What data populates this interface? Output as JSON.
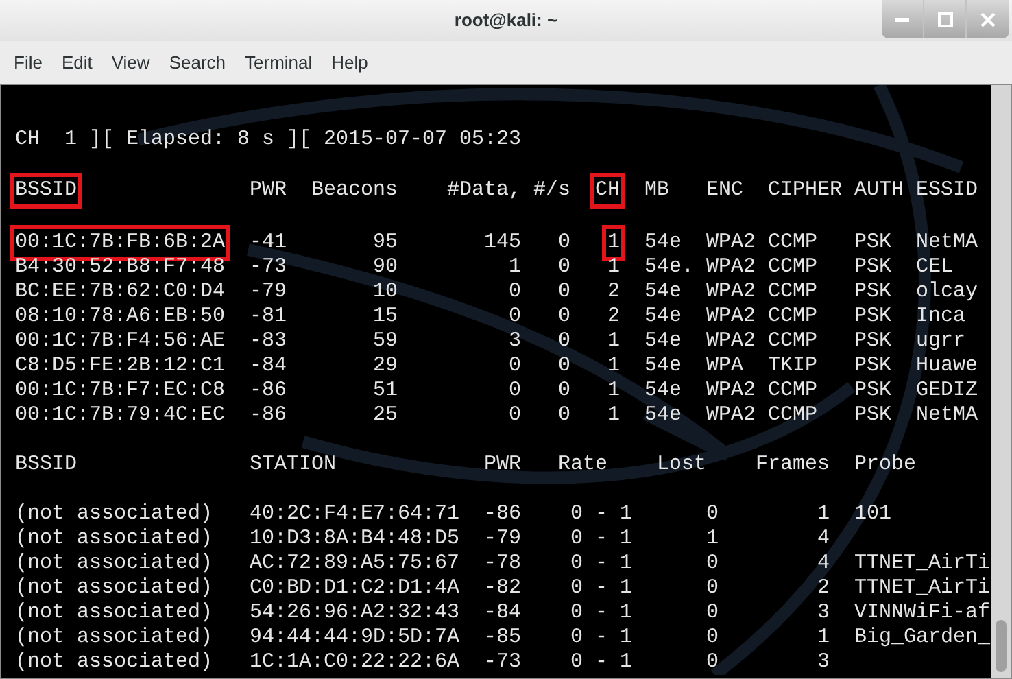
{
  "window": {
    "title": "root@kali: ~"
  },
  "menu": [
    "File",
    "Edit",
    "View",
    "Search",
    "Terminal",
    "Help"
  ],
  "status_line": "CH  1 ][ Elapsed: 8 s ][ 2015-07-07 05:23",
  "networks": {
    "columns": [
      {
        "label": "BSSID",
        "highlighted": true
      },
      {
        "label": "PWR",
        "highlighted": false
      },
      {
        "label": "Beacons",
        "highlighted": false
      },
      {
        "label": "#Data,",
        "highlighted": false
      },
      {
        "label": "#/s",
        "highlighted": false
      },
      {
        "label": "CH",
        "highlighted": true
      },
      {
        "label": "MB",
        "highlighted": false
      },
      {
        "label": "ENC",
        "highlighted": false
      },
      {
        "label": "CIPHER",
        "highlighted": false
      },
      {
        "label": "AUTH",
        "highlighted": false
      },
      {
        "label": "ESSID",
        "highlighted": false
      }
    ],
    "rows": [
      {
        "highlighted": true,
        "cells": [
          "00:1C:7B:FB:6B:2A",
          "-41",
          "95",
          "145",
          "0",
          "1",
          "54e",
          "WPA2",
          "CCMP",
          "PSK",
          "NetMA"
        ]
      },
      {
        "highlighted": false,
        "cells": [
          "B4:30:52:B8:F7:48",
          "-73",
          "90",
          "1",
          "0",
          "1",
          "54e.",
          "WPA2",
          "CCMP",
          "PSK",
          "CEL"
        ]
      },
      {
        "highlighted": false,
        "cells": [
          "BC:EE:7B:62:C0:D4",
          "-79",
          "10",
          "0",
          "0",
          "2",
          "54e",
          "WPA2",
          "CCMP",
          "PSK",
          "olcay"
        ]
      },
      {
        "highlighted": false,
        "cells": [
          "08:10:78:A6:EB:50",
          "-81",
          "15",
          "0",
          "0",
          "2",
          "54e",
          "WPA2",
          "CCMP",
          "PSK",
          "Inca"
        ]
      },
      {
        "highlighted": false,
        "cells": [
          "00:1C:7B:F4:56:AE",
          "-83",
          "59",
          "3",
          "0",
          "1",
          "54e",
          "WPA2",
          "CCMP",
          "PSK",
          "ugrr"
        ]
      },
      {
        "highlighted": false,
        "cells": [
          "C8:D5:FE:2B:12:C1",
          "-84",
          "29",
          "0",
          "0",
          "1",
          "54e",
          "WPA",
          "TKIP",
          "PSK",
          "Huawe"
        ]
      },
      {
        "highlighted": false,
        "cells": [
          "00:1C:7B:F7:EC:C8",
          "-86",
          "51",
          "0",
          "0",
          "1",
          "54e",
          "WPA2",
          "CCMP",
          "PSK",
          "GEDIZ"
        ]
      },
      {
        "highlighted": false,
        "cells": [
          "00:1C:7B:79:4C:EC",
          "-86",
          "25",
          "0",
          "0",
          "1",
          "54e",
          "WPA2",
          "CCMP",
          "PSK",
          "NetMA"
        ]
      }
    ]
  },
  "stations": {
    "columns": [
      "BSSID",
      "STATION",
      "PWR",
      "Rate",
      "Lost",
      "Frames",
      "Probe"
    ],
    "rows": [
      {
        "cells": [
          "(not associated)",
          "40:2C:F4:E7:64:71",
          "-86",
          "0 - 1",
          "0",
          "1",
          "101"
        ]
      },
      {
        "cells": [
          "(not associated)",
          "10:D3:8A:B4:48:D5",
          "-79",
          "0 - 1",
          "1",
          "4"
        ]
      },
      {
        "cells": [
          "(not associated)",
          "AC:72:89:A5:75:67",
          "-78",
          "0 - 1",
          "0",
          "4",
          "TTNET_AirTi"
        ]
      },
      {
        "cells": [
          "(not associated)",
          "C0:BD:D1:C2:D1:4A",
          "-82",
          "0 - 1",
          "0",
          "2",
          "TTNET_AirTi"
        ]
      },
      {
        "cells": [
          "(not associated)",
          "54:26:96:A2:32:43",
          "-84",
          "0 - 1",
          "0",
          "3",
          "VINNWiFi-af"
        ]
      },
      {
        "cells": [
          "(not associated)",
          "94:44:44:9D:5D:7A",
          "-85",
          "0 - 1",
          "0",
          "1",
          "Big_Garden_"
        ]
      },
      {
        "cells": [
          "(not associated)",
          "1C:1A:C0:22:22:6A",
          "-73",
          "0 - 1",
          "0",
          "3"
        ]
      }
    ]
  }
}
